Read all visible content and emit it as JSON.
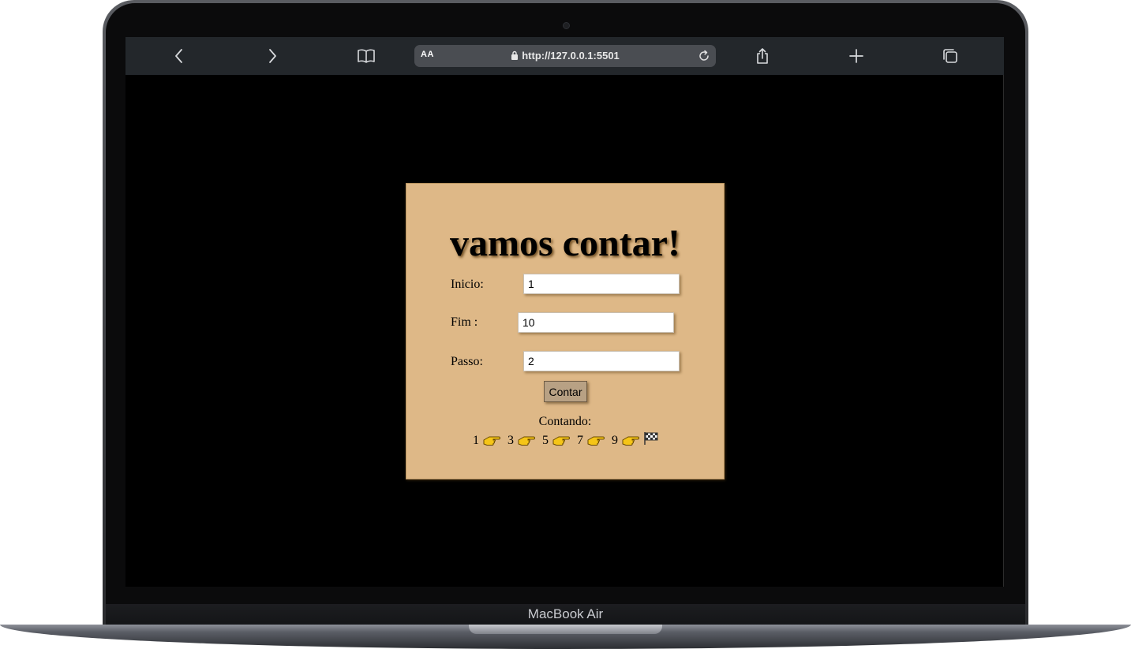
{
  "device": {
    "model_label": "MacBook Air"
  },
  "browser": {
    "text_size_label": "AA",
    "url": "http://127.0.0.1:5501",
    "icons": {
      "back": "chevron-left-icon",
      "forward": "chevron-right-icon",
      "bookmarks": "book-icon",
      "lock": "lock-icon",
      "reload": "reload-icon",
      "share": "share-icon",
      "new_tab": "plus-icon",
      "tabs": "tabs-icon"
    }
  },
  "page": {
    "title": "vamos contar!",
    "inicio_label": "Inicio:",
    "inicio_value": "1",
    "fim_label": "Fim :",
    "fim_value": "10",
    "passo_label": "Passo:",
    "passo_value": "2",
    "button_label": "Contar",
    "result_heading": "Contando:",
    "sequence": [
      "1",
      "3",
      "5",
      "7",
      "9"
    ],
    "sequence_separator_icon": "pointing-hand-icon",
    "sequence_end_icon": "checkered-flag-icon"
  },
  "colors": {
    "card_background": "#deb887",
    "screen_background": "#000000",
    "toolbar_background": "#23272b"
  }
}
